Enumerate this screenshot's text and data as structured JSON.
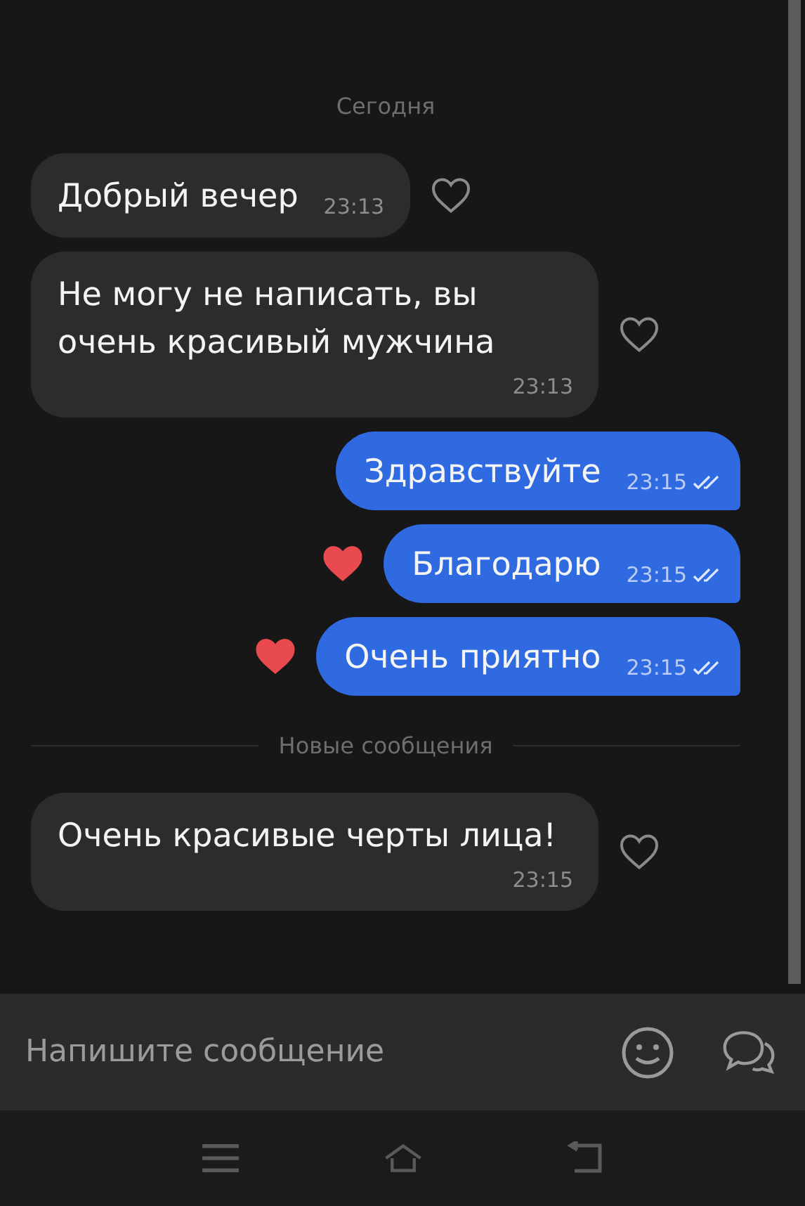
{
  "feed": [
    {
      "kind": "date",
      "text": "Сегодня"
    },
    {
      "kind": "message",
      "outgoing": false,
      "text": "Добрый вечер",
      "time": "23:13",
      "liked": false,
      "inline_time": true
    },
    {
      "kind": "message",
      "outgoing": false,
      "text": "Не могу не написать, вы очень красивый мужчина",
      "time": "23:13",
      "liked": false,
      "inline_time": false
    },
    {
      "kind": "message",
      "outgoing": true,
      "text": "Здравствуйте",
      "time": "23:15",
      "liked": false,
      "read": true,
      "inline_time": true
    },
    {
      "kind": "message",
      "outgoing": true,
      "text": "Благодарю",
      "time": "23:15",
      "liked": true,
      "read": true,
      "inline_time": true
    },
    {
      "kind": "message",
      "outgoing": true,
      "text": "Очень приятно",
      "time": "23:15",
      "liked": true,
      "read": true,
      "inline_time": true
    },
    {
      "kind": "divider",
      "text": "Новые сообщения"
    },
    {
      "kind": "message",
      "outgoing": false,
      "text": "Очень красивые черты лица!",
      "time": "23:15",
      "liked": false,
      "inline_time": false
    }
  ],
  "composer": {
    "placeholder": "Напишите сообщение"
  }
}
